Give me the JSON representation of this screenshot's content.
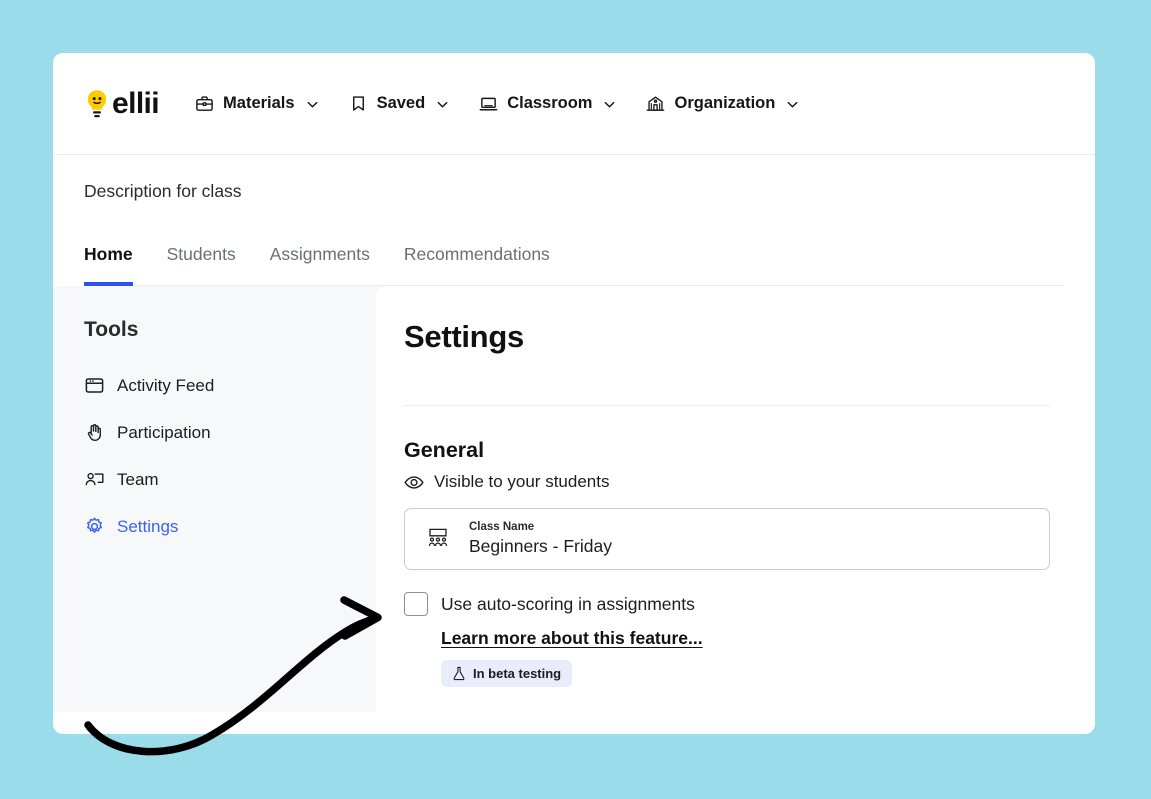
{
  "canvas": {
    "background_color": "#9bdcea",
    "card_background": "#ffffff"
  },
  "topnav": {
    "brand": {
      "name": "ellii",
      "logo_icon": "lightbulb-face-icon",
      "logo_color": "#ffcc00"
    },
    "items": [
      {
        "label": "Materials",
        "icon": "briefcase-icon",
        "has_caret": true
      },
      {
        "label": "Saved",
        "icon": "bookmark-icon",
        "has_caret": true
      },
      {
        "label": "Classroom",
        "icon": "laptop-icon",
        "has_caret": true
      },
      {
        "label": "Organization",
        "icon": "school-building-icon",
        "has_caret": true
      }
    ]
  },
  "class_header": {
    "description": "Description for class",
    "tabs": [
      {
        "label": "Home",
        "active": true
      },
      {
        "label": "Students",
        "active": false
      },
      {
        "label": "Assignments",
        "active": false
      },
      {
        "label": "Recommendations",
        "active": false
      }
    ],
    "active_tab_color": "#2f51ec"
  },
  "sidebar": {
    "title": "Tools",
    "items": [
      {
        "label": "Activity Feed",
        "icon": "window-feed-icon",
        "active": false
      },
      {
        "label": "Participation",
        "icon": "raised-hand-icon",
        "active": false
      },
      {
        "label": "Team",
        "icon": "person-board-icon",
        "active": false
      },
      {
        "label": "Settings",
        "icon": "gear-icon",
        "active": true
      }
    ],
    "active_color": "#3b63f0"
  },
  "panel": {
    "title": "Settings",
    "section": {
      "heading": "General",
      "visibility": {
        "icon": "eye-icon",
        "text": "Visible to your students"
      },
      "class_name_field": {
        "icon": "classroom-icon",
        "label": "Class Name",
        "value": "Beginners - Friday",
        "placeholder": "Class Name"
      },
      "auto_scoring": {
        "checked": false,
        "label": "Use auto-scoring in assignments",
        "learn_more_label": "Learn more about this feature...",
        "badge": {
          "icon": "flask-icon",
          "label": "In beta testing",
          "background_color": "#e9ecfb"
        }
      }
    }
  },
  "annotation": {
    "arrow": {
      "color": "#000000",
      "points_to": "auto-scoring-checkbox"
    }
  }
}
